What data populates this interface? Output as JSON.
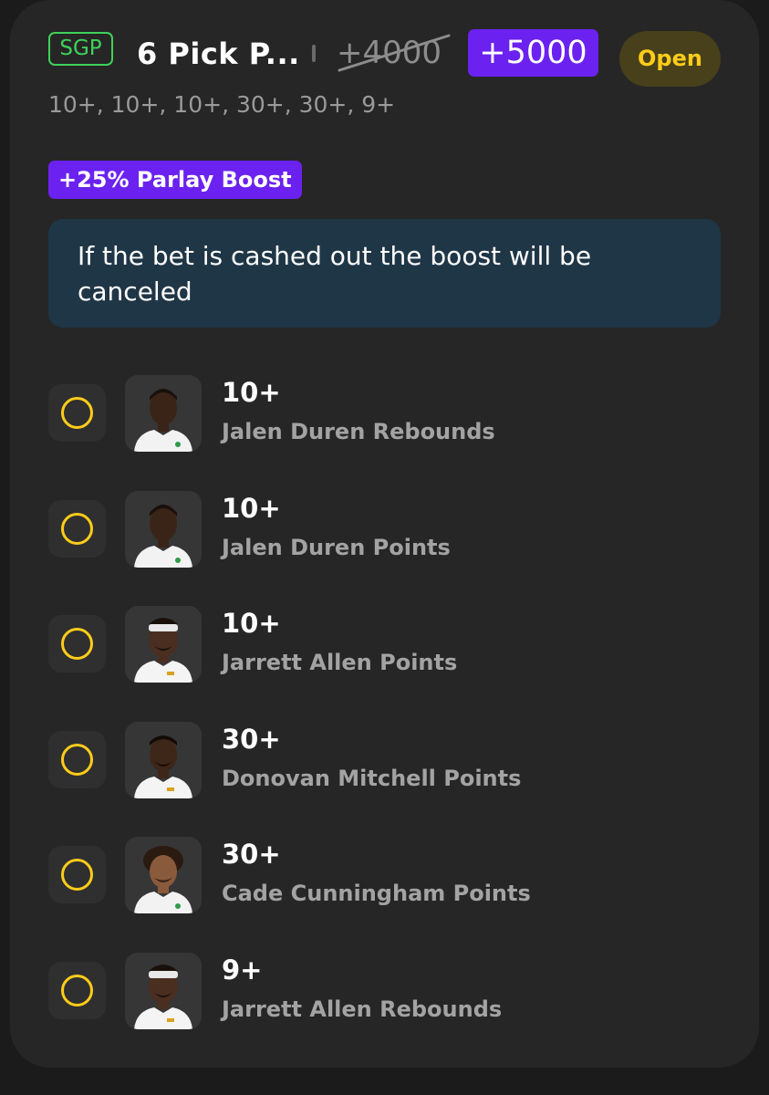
{
  "header": {
    "badge": "SGP",
    "title": "6 Pick P...",
    "original_odds": "+4000",
    "boosted_odds": "+5000",
    "status": "Open"
  },
  "subtitle": "10+, 10+, 10+, 30+, 30+, 9+",
  "boost": {
    "label": "+25% Parlay Boost",
    "notice": "If the bet is cashed out the boost will be canceled"
  },
  "legs": [
    {
      "line": "10+",
      "description": "Jalen Duren Rebounds",
      "avatar_icon": "player-headshot-icon"
    },
    {
      "line": "10+",
      "description": "Jalen Duren Points",
      "avatar_icon": "player-headshot-icon"
    },
    {
      "line": "10+",
      "description": "Jarrett Allen Points",
      "avatar_icon": "player-headshot-icon"
    },
    {
      "line": "30+",
      "description": "Donovan Mitchell Points",
      "avatar_icon": "player-headshot-icon"
    },
    {
      "line": "30+",
      "description": "Cade Cunningham Points",
      "avatar_icon": "player-headshot-icon"
    },
    {
      "line": "9+",
      "description": "Jarrett Allen Rebounds",
      "avatar_icon": "player-headshot-icon"
    }
  ],
  "colors": {
    "background": "#1b1b1b",
    "card": "#262626",
    "sgp_green": "#3ed15a",
    "boost_purple": "#6b22f0",
    "status_yellow": "#ffcc1a",
    "notice_bg": "#1f3646"
  }
}
